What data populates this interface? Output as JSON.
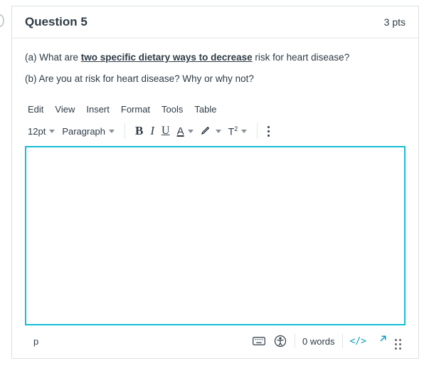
{
  "header": {
    "title": "Question 5",
    "points": "3 pts"
  },
  "prompt": {
    "a_prefix": "(a) What are ",
    "a_underlined": "two specific dietary ways to decrease",
    "a_suffix": " risk for heart disease?",
    "b": "(b) Are you at risk for heart disease? Why or why not?"
  },
  "menu": {
    "edit": "Edit",
    "view": "View",
    "insert": "Insert",
    "format": "Format",
    "tools": "Tools",
    "table": "Table"
  },
  "toolbar": {
    "font_size": "12pt",
    "block": "Paragraph",
    "bold": "B",
    "italic": "I",
    "underline": "U",
    "text_color": "A",
    "highlight": "✎",
    "superscript": "T²"
  },
  "statusbar": {
    "path": "p",
    "words": "0 words",
    "html": "</>"
  }
}
